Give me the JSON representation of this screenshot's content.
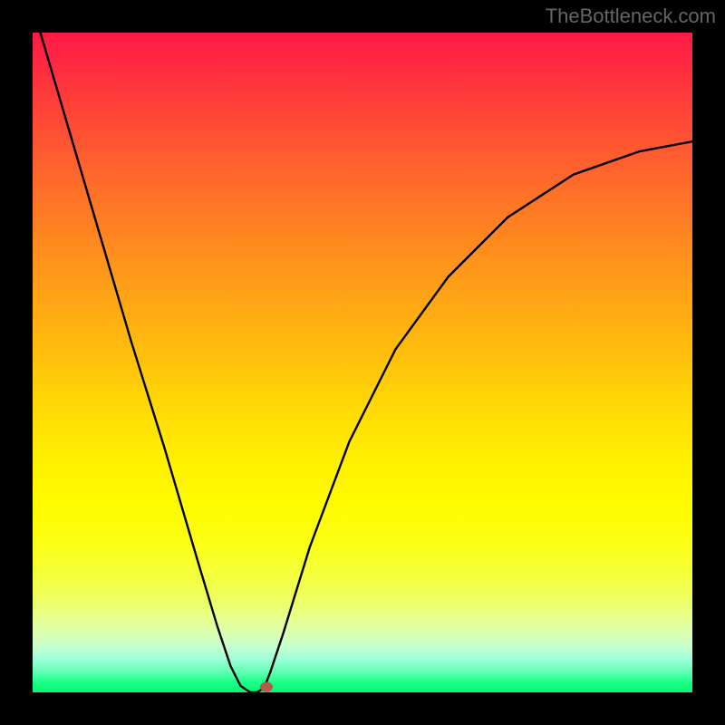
{
  "watermark": "TheBottleneck.com",
  "chart_data": {
    "type": "line",
    "title": "",
    "xlabel": "",
    "ylabel": "",
    "xlim": [
      0,
      100
    ],
    "ylim": [
      0,
      100
    ],
    "series": [
      {
        "name": "bottleneck-curve",
        "x": [
          0,
          5,
          10,
          15,
          20,
          25,
          28,
          30,
          31.5,
          33,
          34,
          34.8,
          35.2,
          36,
          38,
          42,
          48,
          55,
          63,
          72,
          82,
          92,
          100
        ],
        "y": [
          104,
          87,
          70,
          53,
          37,
          20,
          10,
          4,
          1,
          0,
          0,
          0.5,
          1,
          3,
          9,
          22,
          38,
          52,
          63,
          72,
          78.5,
          82,
          83.5
        ]
      }
    ],
    "marker": {
      "x": 35.5,
      "y": 0.8,
      "color": "#b85a4a"
    },
    "gradient_semantics": "top=red=high bottleneck, bottom=green=ideal (0% bottleneck)"
  },
  "colors": {
    "background": "#000000",
    "curve": "#000000",
    "marker": "#b85a4a",
    "watermark": "#666666"
  }
}
